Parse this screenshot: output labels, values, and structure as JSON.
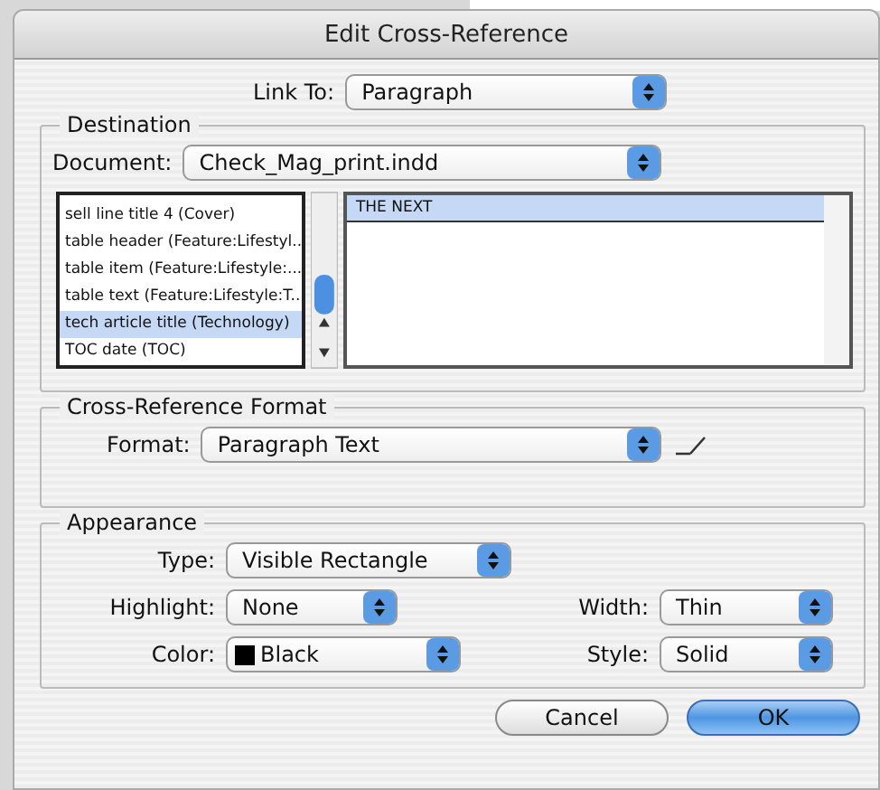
{
  "window": {
    "title": "Edit Cross-Reference"
  },
  "link_to": {
    "label": "Link To:",
    "value": "Paragraph"
  },
  "destination": {
    "title": "Destination",
    "document": {
      "label": "Document:",
      "value": "Check_Mag_print.indd"
    },
    "styles": [
      {
        "text": "sell line title 4 (Cover)",
        "selected": false
      },
      {
        "text": "table header (Feature:Lifestyl...",
        "selected": false
      },
      {
        "text": "table item (Feature:Lifestyle:...",
        "selected": false
      },
      {
        "text": "table text (Feature:Lifestyle:T...",
        "selected": false
      },
      {
        "text": "tech article title (Technology)",
        "selected": true
      },
      {
        "text": "TOC date (TOC)",
        "selected": false
      }
    ],
    "paragraphs": [
      {
        "text": "THE NEXT",
        "selected": true
      }
    ]
  },
  "format_group": {
    "title": "Cross-Reference Format",
    "format": {
      "label": "Format:",
      "value": "Paragraph Text"
    }
  },
  "appearance": {
    "title": "Appearance",
    "type": {
      "label": "Type:",
      "value": "Visible Rectangle"
    },
    "highlight": {
      "label": "Highlight:",
      "value": "None"
    },
    "width": {
      "label": "Width:",
      "value": "Thin"
    },
    "color": {
      "label": "Color:",
      "value": "Black",
      "color": "#000000"
    },
    "style": {
      "label": "Style:",
      "value": "Solid"
    }
  },
  "buttons": [
    {
      "label": "Cancel",
      "default": false
    },
    {
      "label": "OK",
      "default": true
    }
  ]
}
